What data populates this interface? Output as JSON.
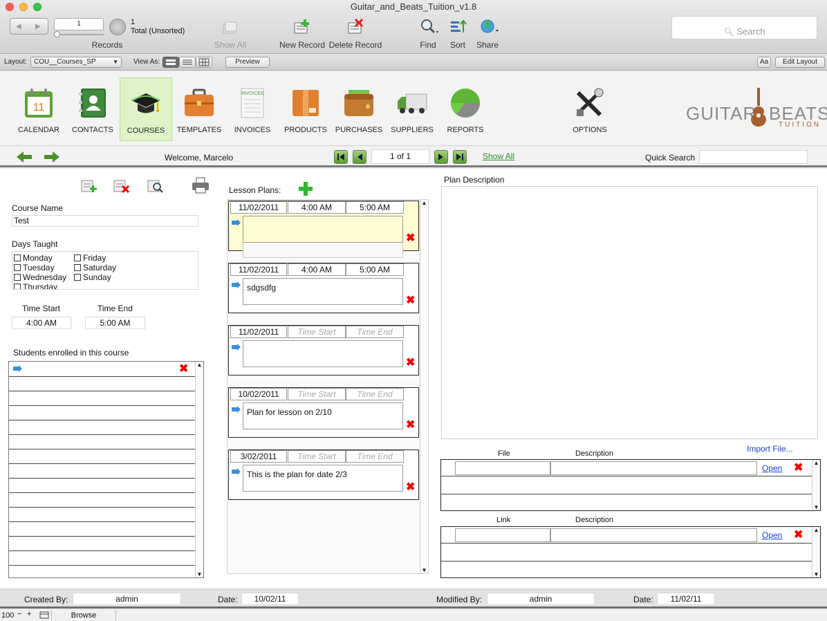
{
  "window": {
    "title": "Guitar_and_Beats_Tuition_v1.8"
  },
  "toolbar": {
    "record_number": "1",
    "records_count": "1",
    "records_status": "Total (Unsorted)",
    "records_label": "Records",
    "show_all": "Show All",
    "new_record": "New Record",
    "delete_record": "Delete Record",
    "find": "Find",
    "sort": "Sort",
    "share": "Share",
    "search_placeholder": "Search"
  },
  "layoutbar": {
    "layout_label": "Layout:",
    "layout_value": "COU__Courses_SP",
    "view_as_label": "View As:",
    "preview": "Preview",
    "aa": "Aa",
    "edit_layout": "Edit Layout"
  },
  "nav": {
    "items": [
      {
        "label": "CALENDAR",
        "icon": "calendar-icon"
      },
      {
        "label": "CONTACTS",
        "icon": "contacts-icon"
      },
      {
        "label": "COURSES",
        "icon": "graduation-cap-icon"
      },
      {
        "label": "TEMPLATES",
        "icon": "briefcase-icon"
      },
      {
        "label": "INVOICES",
        "icon": "invoice-icon"
      },
      {
        "label": "PRODUCTS",
        "icon": "box-icon"
      },
      {
        "label": "PURCHASES",
        "icon": "wallet-icon"
      },
      {
        "label": "SUPPLIERS",
        "icon": "truck-icon"
      },
      {
        "label": "REPORTS",
        "icon": "pie-chart-icon"
      },
      {
        "label": "OPTIONS",
        "icon": "tools-icon"
      }
    ],
    "calendar_day": "11",
    "invoice_tag": "INVOICES",
    "logo_left": "GUITAR",
    "logo_right": "BEATS",
    "logo_sub": "TUITION"
  },
  "recbar": {
    "welcome": "Welcome, Marcelo",
    "page": "1 of 1",
    "show_all": "Show All",
    "quick_search_label": "Quick Search",
    "quick_search_value": ""
  },
  "course": {
    "name_label": "Course Name",
    "name": "Test",
    "days_label": "Days Taught",
    "days": [
      "Monday",
      "Tuesday",
      "Wednesday",
      "Thursday",
      "Friday",
      "Saturday",
      "Sunday"
    ],
    "time_start_label": "Time Start",
    "time_end_label": "Time End",
    "time_start": "4:00 AM",
    "time_end": "5:00 AM",
    "students_label": "Students enrolled in this course"
  },
  "lesson_plans": {
    "label": "Lesson Plans:",
    "placeholder_start": "Time Start",
    "placeholder_end": "Time End",
    "items": [
      {
        "date": "11/02/2011",
        "start": "4:00 AM",
        "end": "5:00 AM",
        "note": ""
      },
      {
        "date": "11/02/2011",
        "start": "4:00 AM",
        "end": "5:00 AM",
        "note": "sdgsdfg"
      },
      {
        "date": "11/02/2011",
        "start": "",
        "end": "",
        "note": ""
      },
      {
        "date": "10/02/2011",
        "start": "",
        "end": "",
        "note": "Plan for lesson on 2/10"
      },
      {
        "date": "3/02/2011",
        "start": "",
        "end": "",
        "note": "This is the plan for date 2/3"
      }
    ]
  },
  "plan": {
    "description_label": "Plan Description",
    "import_file": "Import File...",
    "file_header": "File",
    "file_desc_header": "Description",
    "link_header": "Link",
    "link_desc_header": "Description",
    "open": "Open"
  },
  "footer": {
    "created_by_label": "Created By:",
    "created_by": "admin",
    "created_date_label": "Date:",
    "created_date": "10/02/11",
    "modified_by_label": "Modified By:",
    "modified_by": "admin",
    "modified_date_label": "Date:",
    "modified_date": "11/02/11"
  },
  "status": {
    "zoom": "100",
    "mode": "Browse"
  },
  "colors": {
    "accent_green": "#5d9a32",
    "active_nav": "#def3c8",
    "link_blue": "#1a3fd4",
    "delete_red": "#e00000"
  }
}
